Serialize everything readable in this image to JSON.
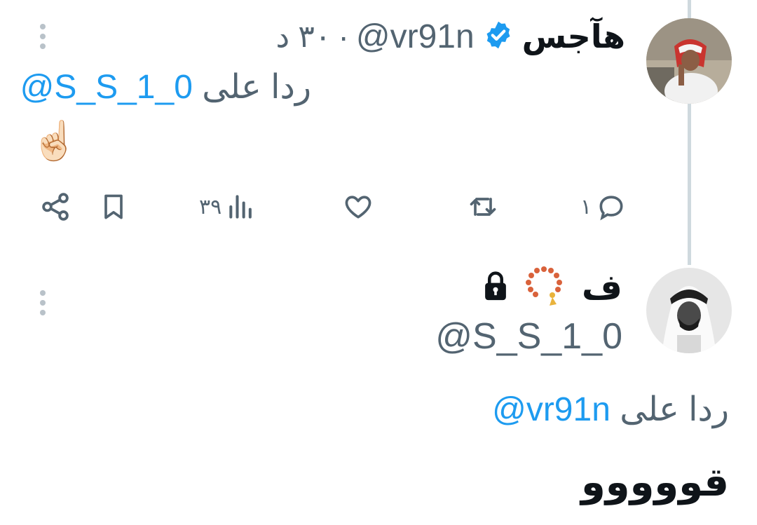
{
  "tweet1": {
    "display_name": "هآجس",
    "handle": "@vr91n",
    "separator": "·",
    "time": "٣٠ د",
    "reply_prefix": "ردا على",
    "reply_mention": "@S_S_1_0",
    "emoji": "☝🏻",
    "actions": {
      "replies": "١",
      "retweets": "",
      "likes": "",
      "views": "٣٩"
    }
  },
  "tweet2": {
    "display_name": "ف",
    "handle": "@S_S_1_0",
    "reply_prefix": "ردا على",
    "reply_mention": "@vr91n",
    "text": "قووووو"
  },
  "colors": {
    "verified": "#1d9bf0",
    "mention": "#1d9bf0",
    "secondary_text": "#536471",
    "thread_line": "#cfd9de"
  },
  "icons": [
    "verified-badge-icon",
    "more-icon",
    "reply-icon",
    "retweet-icon",
    "like-icon",
    "views-icon",
    "bookmark-icon",
    "share-icon",
    "prayer-beads-icon",
    "lock-icon"
  ]
}
